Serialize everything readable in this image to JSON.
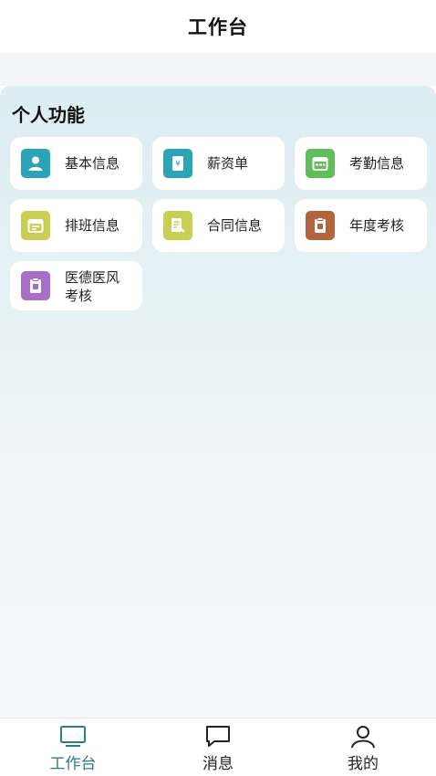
{
  "header": {
    "title": "工作台"
  },
  "section": {
    "title": "个人功能"
  },
  "items": [
    {
      "label": "基本信息",
      "icon": "person-icon",
      "color": "#2aa4b6"
    },
    {
      "label": "薪资单",
      "icon": "payslip-icon",
      "color": "#2aa4b6"
    },
    {
      "label": "考勤信息",
      "icon": "calendar-icon",
      "color": "#5fbd5a"
    },
    {
      "label": "排班信息",
      "icon": "schedule-icon",
      "color": "#c9cf52"
    },
    {
      "label": "合同信息",
      "icon": "contract-icon",
      "color": "#c9cf52"
    },
    {
      "label": "年度考核",
      "icon": "clipboard-icon",
      "color": "#b4643c"
    },
    {
      "label": "医德医风考核",
      "line1": "医德医风",
      "line2": "考核",
      "icon": "review-icon",
      "color": "#a86fc9"
    }
  ],
  "tabs": [
    {
      "label": "工作台",
      "icon": "monitor-icon",
      "active": true
    },
    {
      "label": "消息",
      "icon": "chat-icon",
      "active": false
    },
    {
      "label": "我的",
      "icon": "user-icon",
      "active": false
    }
  ],
  "colors": {
    "accent": "#2e7d7f",
    "panel_top": "#dcedf3"
  }
}
